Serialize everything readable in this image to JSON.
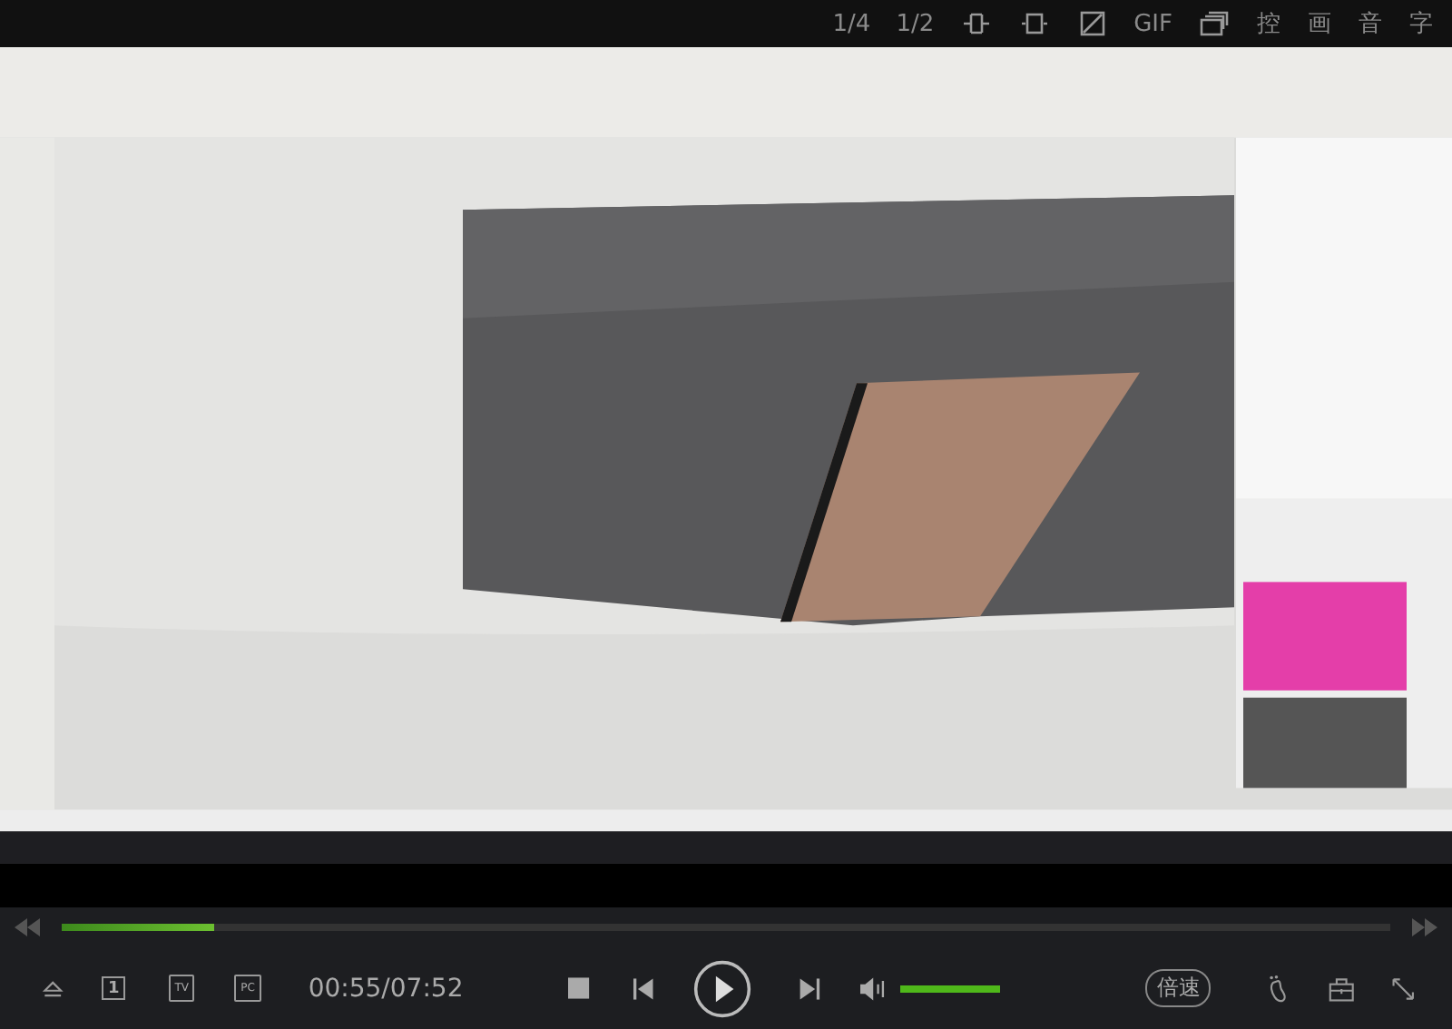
{
  "top_bar": {
    "items": [
      {
        "kind": "text",
        "label": "1/4"
      },
      {
        "kind": "text",
        "label": "1/2"
      },
      {
        "kind": "crop"
      },
      {
        "kind": "fit"
      },
      {
        "kind": "rotate"
      },
      {
        "kind": "text",
        "label": "GIF"
      },
      {
        "kind": "windows"
      },
      {
        "kind": "text",
        "label": "控"
      },
      {
        "kind": "text",
        "label": "画"
      },
      {
        "kind": "text",
        "label": "音"
      },
      {
        "kind": "text",
        "label": "字"
      }
    ]
  },
  "progress": {
    "level": 0.115
  },
  "controls": {
    "left": [
      {
        "kind": "eject"
      },
      {
        "kind": "boxed",
        "label": "1"
      },
      {
        "kind": "screen",
        "label": "TV"
      },
      {
        "kind": "screen",
        "label": "PC"
      }
    ],
    "time": "00:55/07:52",
    "volume": {
      "level": 1
    },
    "speed": "倍速"
  }
}
